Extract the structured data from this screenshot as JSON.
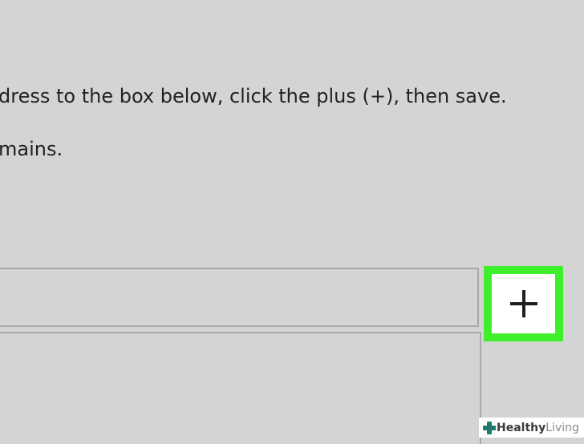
{
  "instructions": {
    "line1": "dress to the box below, click the plus (+), then save.",
    "line2": "mains."
  },
  "entry": {
    "value": "",
    "placeholder": ""
  },
  "add_button": {
    "icon": "plus-icon",
    "highlight_color": "#3df02b"
  },
  "watermark": {
    "bold": "Healthy",
    "light": " Living",
    "icon": "medical-cross-icon",
    "color": "#1f7a6b"
  }
}
